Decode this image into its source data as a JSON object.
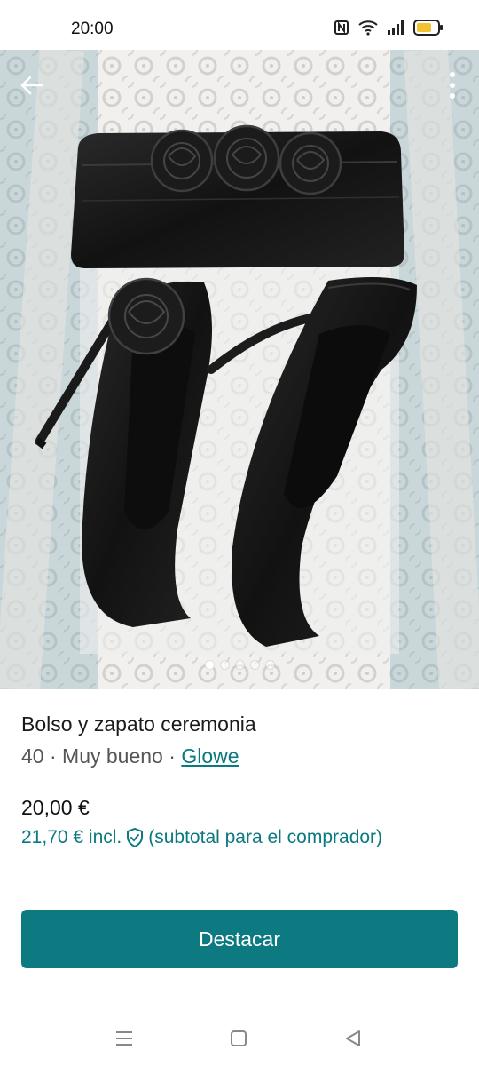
{
  "status_bar": {
    "time": "20:00",
    "icons": [
      "nfc-icon",
      "wifi-icon",
      "signal-icon",
      "battery-icon"
    ]
  },
  "photo": {
    "pages_total": 5,
    "active_page": 1
  },
  "listing": {
    "title": "Bolso y zapato ceremonia",
    "size": "40",
    "condition": "Muy bueno",
    "separator": "·",
    "brand": "Glowe",
    "price": "20,00 €",
    "price_incl": "21,70 € incl.",
    "price_incl_note": "(subtotal para el comprador)"
  },
  "actions": {
    "promote_label": "Destacar"
  },
  "colors": {
    "accent": "#0c7a80",
    "battery": "#f2c232"
  }
}
